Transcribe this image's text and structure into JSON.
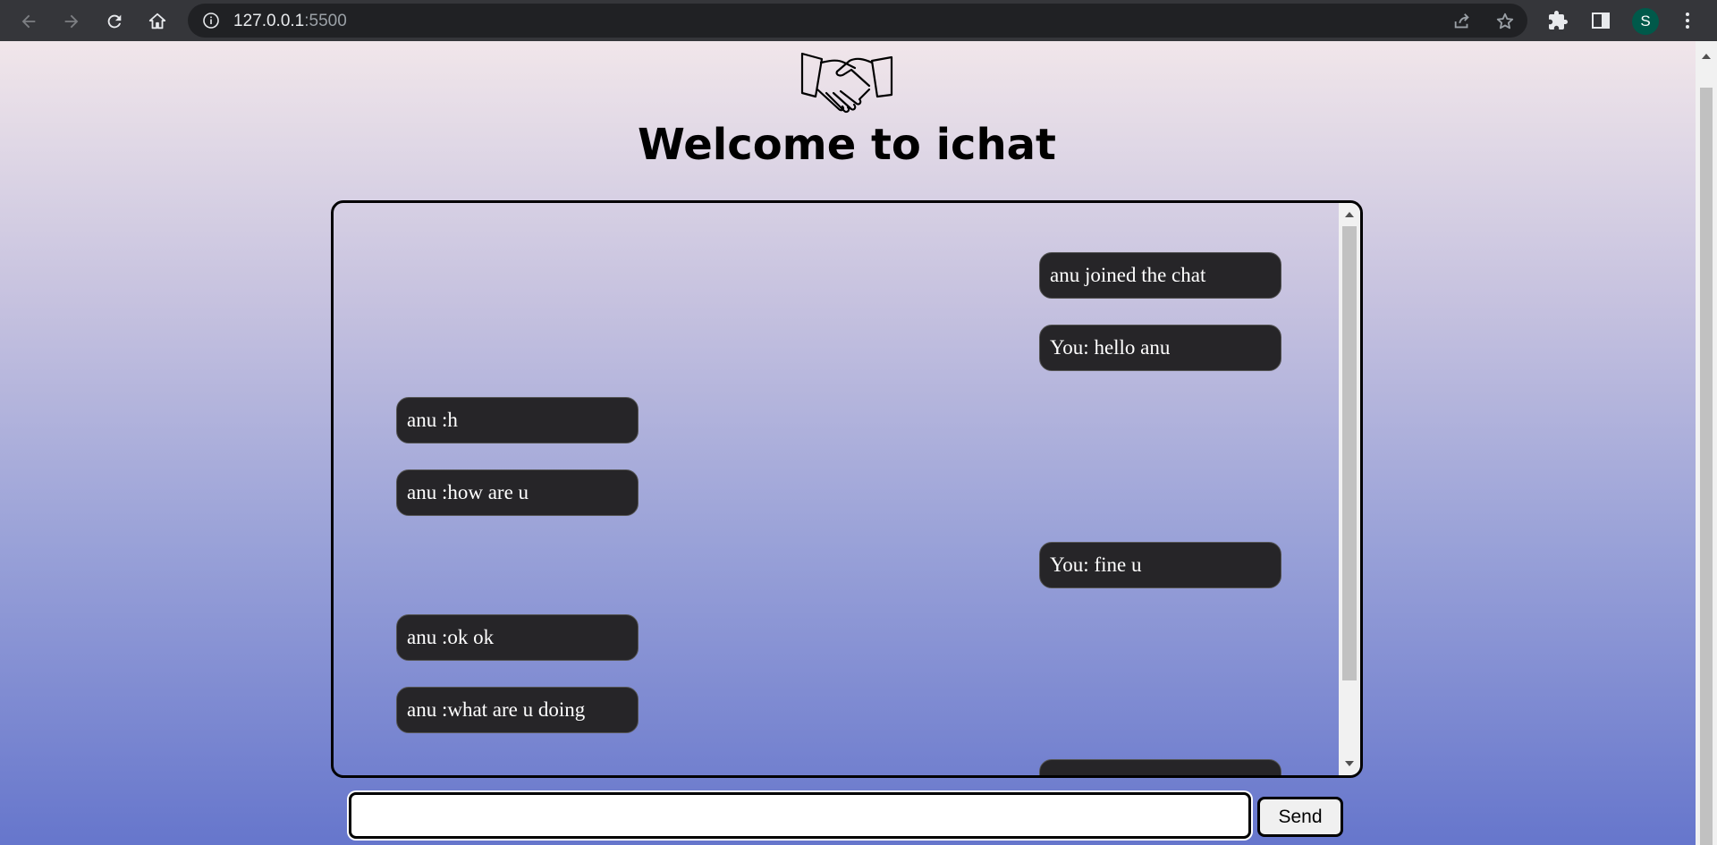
{
  "browser": {
    "url_host": "127.0.0.1",
    "url_port": ":5500",
    "profile_initial": "S",
    "icons": [
      "back-icon",
      "forward-icon",
      "reload-icon",
      "home-icon",
      "site-info-icon",
      "share-icon",
      "bookmark-star-icon",
      "extensions-icon",
      "side-panel-icon",
      "menu-icon"
    ]
  },
  "page": {
    "logo_icon": "handshake-icon",
    "title": "Welcome to ichat"
  },
  "chat": {
    "messages": [
      {
        "text": "anu joined the chat",
        "side": "right"
      },
      {
        "text": "You: hello anu",
        "side": "right"
      },
      {
        "text": "anu :h",
        "side": "left"
      },
      {
        "text": "anu :how are u",
        "side": "left"
      },
      {
        "text": "You: fine u",
        "side": "right"
      },
      {
        "text": "anu :ok ok",
        "side": "left"
      },
      {
        "text": "anu :what are u doing",
        "side": "left"
      },
      {
        "text": "",
        "side": "right"
      }
    ]
  },
  "composer": {
    "input_value": "",
    "send_label": "Send"
  },
  "colors": {
    "bubble_bg": "#262528",
    "bubble_text": "#ffffff",
    "gradient_top": "#f1e6ea",
    "gradient_bottom": "#6676cc"
  }
}
